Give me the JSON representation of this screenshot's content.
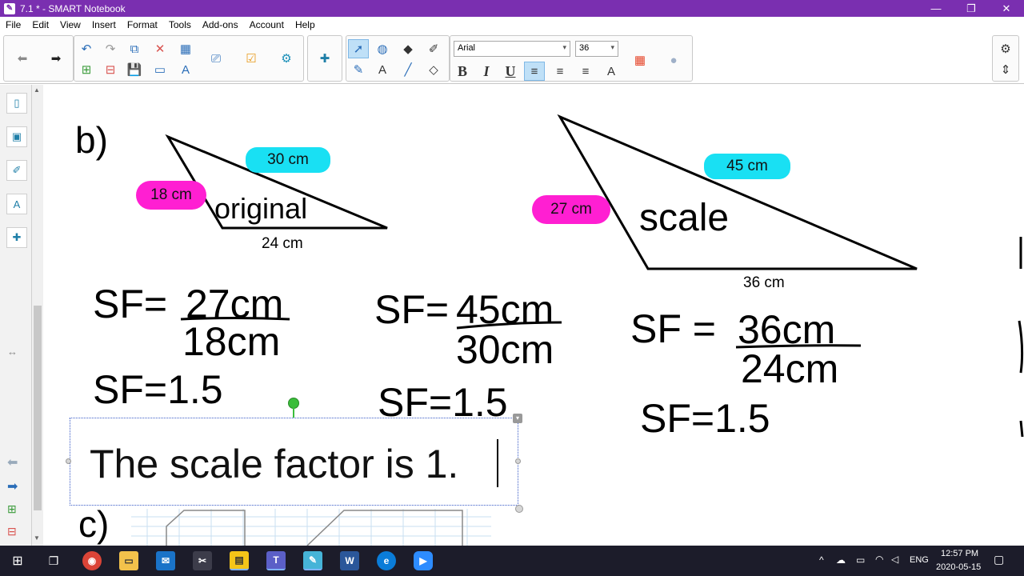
{
  "window": {
    "title": "7.1 * - SMART Notebook",
    "controls": {
      "minimize": "—",
      "restore": "❐",
      "close": "✕"
    }
  },
  "menu": [
    "File",
    "Edit",
    "View",
    "Insert",
    "Format",
    "Tools",
    "Add-ons",
    "Account",
    "Help"
  ],
  "toolbar": {
    "font_name": "Arial",
    "font_size": "36",
    "bold": "B",
    "italic": "I",
    "underline": "U",
    "text_tool": "A"
  },
  "canvas": {
    "part_b_label": "b)",
    "part_c_label": "c)",
    "original_triangle": {
      "label": "original",
      "side_top": "30 cm",
      "side_left": "18 cm",
      "side_bottom": "24 cm"
    },
    "scale_triangle": {
      "label": "scale",
      "side_top": "45 cm",
      "side_left": "27 cm",
      "side_bottom": "36 cm"
    },
    "work": [
      {
        "lhs": "SF=",
        "numerator": "27cm",
        "denominator": "18cm",
        "result": "SF=1.5"
      },
      {
        "lhs": "SF=",
        "numerator": "45cm",
        "denominator": "30cm",
        "result": "SF=1.5"
      },
      {
        "lhs": "SF =",
        "numerator": "36cm",
        "denominator": "24cm",
        "result": "SF=1.5"
      }
    ],
    "textbox_text": "The scale factor is 1."
  },
  "taskbar": {
    "apps": [
      "start",
      "task-view",
      "chrome",
      "file-explorer",
      "mail",
      "snip",
      "sticky-notes",
      "teams",
      "smart-notebook",
      "word",
      "edge",
      "zoom"
    ],
    "language": "ENG",
    "time": "12:57 PM",
    "date": "2020-05-15"
  },
  "colors": {
    "titlebar": "#7a2fb0",
    "cyan_highlight": "#19e0f3",
    "magenta_highlight": "#ff1fd2",
    "taskbar": "#1c1c2a"
  }
}
